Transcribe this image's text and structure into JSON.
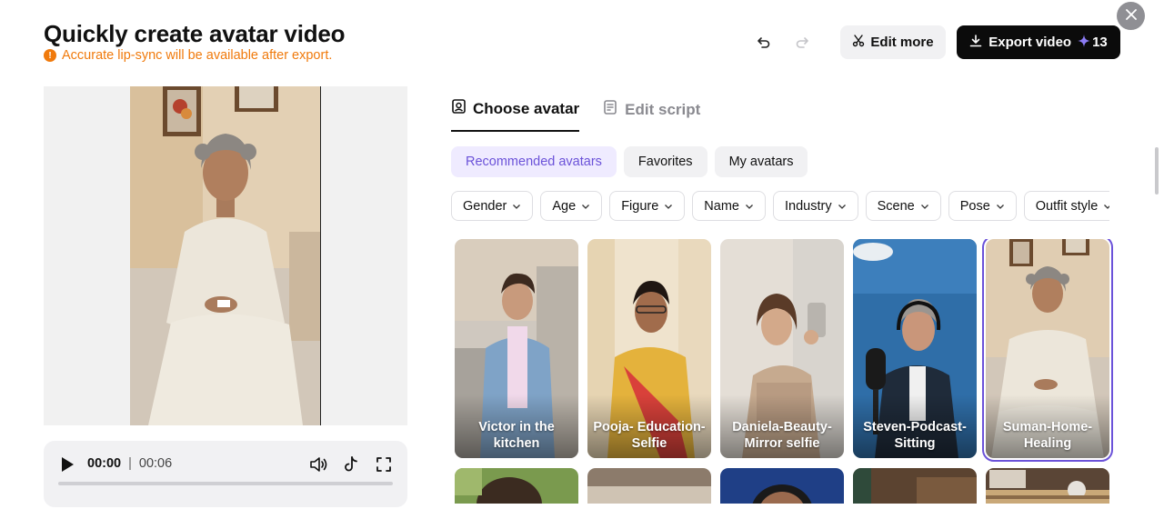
{
  "header": {
    "title": "Quickly create avatar video",
    "notice": "Accurate lip-sync will be available after export.",
    "edit_more_label": "Edit more",
    "export_label": "Export video",
    "export_credits": "13"
  },
  "player": {
    "current_time": "00:00",
    "separator": "|",
    "duration": "00:06",
    "progress": 0
  },
  "tabs": [
    {
      "label": "Choose avatar",
      "active": true
    },
    {
      "label": "Edit script",
      "active": false
    }
  ],
  "categories": [
    {
      "label": "Recommended avatars",
      "active": true
    },
    {
      "label": "Favorites",
      "active": false
    },
    {
      "label": "My avatars",
      "active": false
    }
  ],
  "filters": [
    "Gender",
    "Age",
    "Figure",
    "Name",
    "Industry",
    "Scene",
    "Pose",
    "Outfit style"
  ],
  "avatars": [
    {
      "name": "Victor in the kitchen"
    },
    {
      "name": "Pooja- Education-Selfie"
    },
    {
      "name": "Daniela-Beauty-Mirror selfie"
    },
    {
      "name": "Steven-Podcast-Sitting"
    },
    {
      "name": "Suman-Home-Healing",
      "selected": true
    }
  ],
  "colors": {
    "accent": "#6b52d9",
    "notice": "#f07a0c",
    "export_bg": "#0b0b0b"
  }
}
